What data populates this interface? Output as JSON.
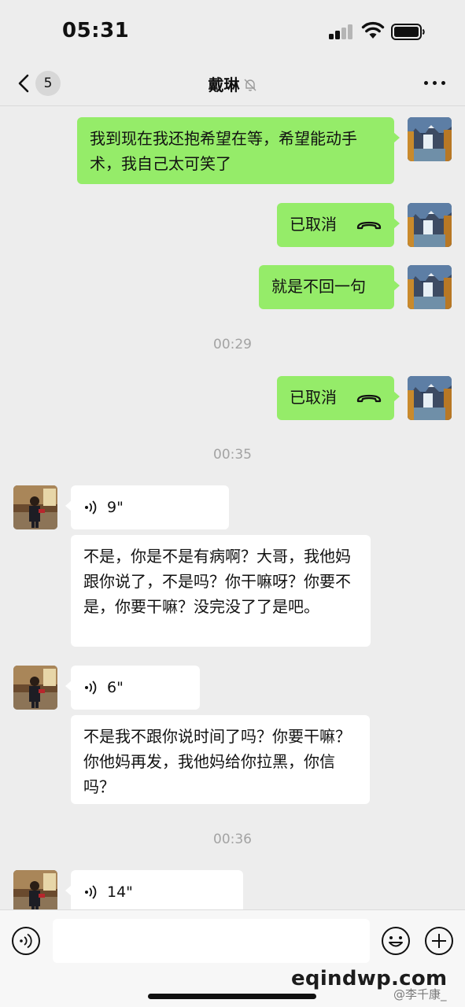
{
  "status_bar": {
    "time": "05:31"
  },
  "nav": {
    "unread_count": "5",
    "title": "戴琳"
  },
  "messages": {
    "m1": {
      "text": "我到现在我还抱希望在等，希望能动手术，我自己太可笑了"
    },
    "m2": {
      "text": "已取消"
    },
    "m3": {
      "text": "就是不回一句"
    },
    "t1": {
      "text": "00:29"
    },
    "m4": {
      "text": "已取消"
    },
    "t2": {
      "text": "00:35"
    },
    "m5": {
      "duration": "9\""
    },
    "m6": {
      "text": "不是，你是不是有病啊？大哥，我他妈跟你说了，不是吗？你干嘛呀？你要不是，你要干嘛？没完没了了是吧。"
    },
    "m7": {
      "duration": "6\""
    },
    "m8": {
      "text": "不是我不跟你说时间了吗？你要干嘛？你他妈再发，我他妈给你拉黑，你信吗？"
    },
    "t3": {
      "text": "00:36"
    },
    "m9": {
      "duration": "14\""
    }
  },
  "input": {
    "value": "",
    "placeholder": ""
  },
  "watermark": {
    "site": "eqindwp.com",
    "handle": "@李千康_"
  },
  "colors": {
    "outgoing_bubble": "#95ec69",
    "incoming_bubble": "#ffffff",
    "background": "#ededed",
    "timestamp": "#a3a3a3"
  },
  "icons": [
    "back-chevron-icon",
    "mute-bell-icon",
    "more-icon",
    "hangup-phone-icon",
    "voice-wave-icon",
    "voice-toggle-icon",
    "emoji-icon",
    "plus-icon",
    "signal-icon",
    "wifi-icon",
    "battery-icon"
  ]
}
